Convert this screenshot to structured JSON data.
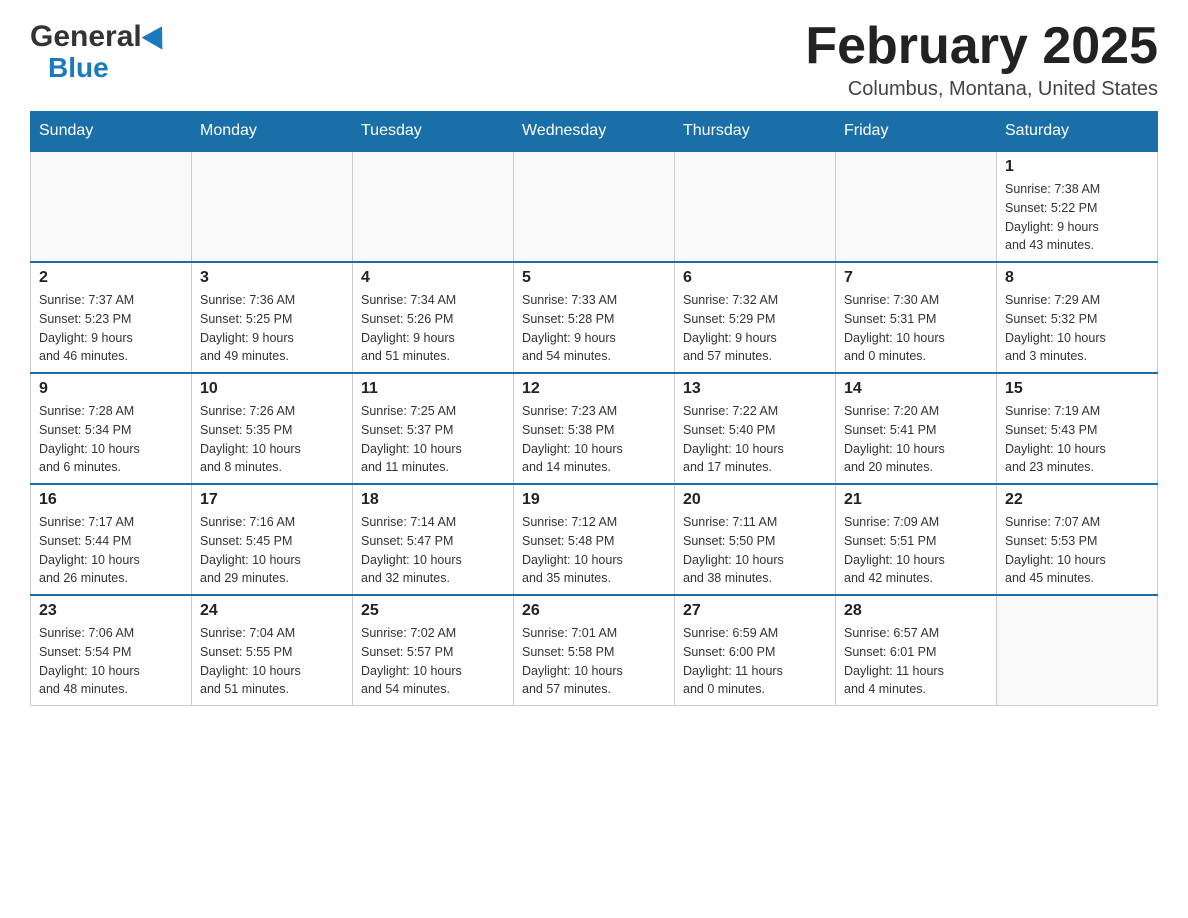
{
  "header": {
    "logo_general": "General",
    "logo_blue": "Blue",
    "month_title": "February 2025",
    "location": "Columbus, Montana, United States"
  },
  "weekdays": [
    "Sunday",
    "Monday",
    "Tuesday",
    "Wednesday",
    "Thursday",
    "Friday",
    "Saturday"
  ],
  "weeks": [
    [
      {
        "day": "",
        "info": ""
      },
      {
        "day": "",
        "info": ""
      },
      {
        "day": "",
        "info": ""
      },
      {
        "day": "",
        "info": ""
      },
      {
        "day": "",
        "info": ""
      },
      {
        "day": "",
        "info": ""
      },
      {
        "day": "1",
        "info": "Sunrise: 7:38 AM\nSunset: 5:22 PM\nDaylight: 9 hours\nand 43 minutes."
      }
    ],
    [
      {
        "day": "2",
        "info": "Sunrise: 7:37 AM\nSunset: 5:23 PM\nDaylight: 9 hours\nand 46 minutes."
      },
      {
        "day": "3",
        "info": "Sunrise: 7:36 AM\nSunset: 5:25 PM\nDaylight: 9 hours\nand 49 minutes."
      },
      {
        "day": "4",
        "info": "Sunrise: 7:34 AM\nSunset: 5:26 PM\nDaylight: 9 hours\nand 51 minutes."
      },
      {
        "day": "5",
        "info": "Sunrise: 7:33 AM\nSunset: 5:28 PM\nDaylight: 9 hours\nand 54 minutes."
      },
      {
        "day": "6",
        "info": "Sunrise: 7:32 AM\nSunset: 5:29 PM\nDaylight: 9 hours\nand 57 minutes."
      },
      {
        "day": "7",
        "info": "Sunrise: 7:30 AM\nSunset: 5:31 PM\nDaylight: 10 hours\nand 0 minutes."
      },
      {
        "day": "8",
        "info": "Sunrise: 7:29 AM\nSunset: 5:32 PM\nDaylight: 10 hours\nand 3 minutes."
      }
    ],
    [
      {
        "day": "9",
        "info": "Sunrise: 7:28 AM\nSunset: 5:34 PM\nDaylight: 10 hours\nand 6 minutes."
      },
      {
        "day": "10",
        "info": "Sunrise: 7:26 AM\nSunset: 5:35 PM\nDaylight: 10 hours\nand 8 minutes."
      },
      {
        "day": "11",
        "info": "Sunrise: 7:25 AM\nSunset: 5:37 PM\nDaylight: 10 hours\nand 11 minutes."
      },
      {
        "day": "12",
        "info": "Sunrise: 7:23 AM\nSunset: 5:38 PM\nDaylight: 10 hours\nand 14 minutes."
      },
      {
        "day": "13",
        "info": "Sunrise: 7:22 AM\nSunset: 5:40 PM\nDaylight: 10 hours\nand 17 minutes."
      },
      {
        "day": "14",
        "info": "Sunrise: 7:20 AM\nSunset: 5:41 PM\nDaylight: 10 hours\nand 20 minutes."
      },
      {
        "day": "15",
        "info": "Sunrise: 7:19 AM\nSunset: 5:43 PM\nDaylight: 10 hours\nand 23 minutes."
      }
    ],
    [
      {
        "day": "16",
        "info": "Sunrise: 7:17 AM\nSunset: 5:44 PM\nDaylight: 10 hours\nand 26 minutes."
      },
      {
        "day": "17",
        "info": "Sunrise: 7:16 AM\nSunset: 5:45 PM\nDaylight: 10 hours\nand 29 minutes."
      },
      {
        "day": "18",
        "info": "Sunrise: 7:14 AM\nSunset: 5:47 PM\nDaylight: 10 hours\nand 32 minutes."
      },
      {
        "day": "19",
        "info": "Sunrise: 7:12 AM\nSunset: 5:48 PM\nDaylight: 10 hours\nand 35 minutes."
      },
      {
        "day": "20",
        "info": "Sunrise: 7:11 AM\nSunset: 5:50 PM\nDaylight: 10 hours\nand 38 minutes."
      },
      {
        "day": "21",
        "info": "Sunrise: 7:09 AM\nSunset: 5:51 PM\nDaylight: 10 hours\nand 42 minutes."
      },
      {
        "day": "22",
        "info": "Sunrise: 7:07 AM\nSunset: 5:53 PM\nDaylight: 10 hours\nand 45 minutes."
      }
    ],
    [
      {
        "day": "23",
        "info": "Sunrise: 7:06 AM\nSunset: 5:54 PM\nDaylight: 10 hours\nand 48 minutes."
      },
      {
        "day": "24",
        "info": "Sunrise: 7:04 AM\nSunset: 5:55 PM\nDaylight: 10 hours\nand 51 minutes."
      },
      {
        "day": "25",
        "info": "Sunrise: 7:02 AM\nSunset: 5:57 PM\nDaylight: 10 hours\nand 54 minutes."
      },
      {
        "day": "26",
        "info": "Sunrise: 7:01 AM\nSunset: 5:58 PM\nDaylight: 10 hours\nand 57 minutes."
      },
      {
        "day": "27",
        "info": "Sunrise: 6:59 AM\nSunset: 6:00 PM\nDaylight: 11 hours\nand 0 minutes."
      },
      {
        "day": "28",
        "info": "Sunrise: 6:57 AM\nSunset: 6:01 PM\nDaylight: 11 hours\nand 4 minutes."
      },
      {
        "day": "",
        "info": ""
      }
    ]
  ]
}
